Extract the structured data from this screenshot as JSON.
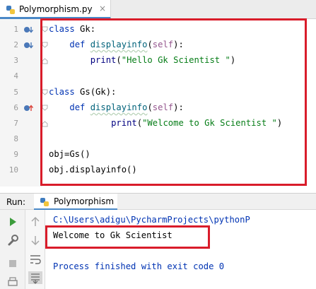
{
  "editor_tab": {
    "filename": "Polymorphism.py",
    "close_glyph": "×"
  },
  "code_lines": [
    {
      "number": "1",
      "text": "class Gk:"
    },
    {
      "number": "2",
      "text": "    def displayinfo(self):"
    },
    {
      "number": "3",
      "text": "        print(\"Hello Gk Scientist \")"
    },
    {
      "number": "4",
      "text": ""
    },
    {
      "number": "5",
      "text": "class Gs(Gk):"
    },
    {
      "number": "6",
      "text": "    def displayinfo(self):"
    },
    {
      "number": "7",
      "text": "            print(\"Welcome to Gk Scientist \")"
    },
    {
      "number": "8",
      "text": ""
    },
    {
      "number": "9",
      "text": "obj=Gs()"
    },
    {
      "number": "10",
      "text": "obj.displayinfo()"
    }
  ],
  "run_panel": {
    "label": "Run:",
    "config_name": "Polymorphism",
    "output": {
      "command_line": "C:\\Users\\adigu\\PycharmProjects\\pythonP",
      "program_output": "Welcome to Gk Scientist",
      "exit_message": "Process finished with exit code 0"
    }
  },
  "colors": {
    "highlight_box": "#d91c2a",
    "keyword": "#0033b3",
    "function_name": "#00627a",
    "self_param": "#94558d",
    "string": "#067d17",
    "run_green": "#3c9c3c",
    "tab_underline": "#4a88c7"
  },
  "icons": {
    "tab_file": "python-file-icon",
    "gutter_line_1": "implemented-by-icon",
    "gutter_line_2": "overridden-method-icon",
    "gutter_line_6": "overrides-method-icon",
    "run_tab": "python-run-config-icon",
    "toolbar": [
      "rerun-icon",
      "scroll-up-icon",
      "wrench-icon",
      "scroll-down-icon",
      "stop-icon",
      "soft-wrap-icon",
      "print-icon",
      "scroll-to-end-icon"
    ]
  }
}
